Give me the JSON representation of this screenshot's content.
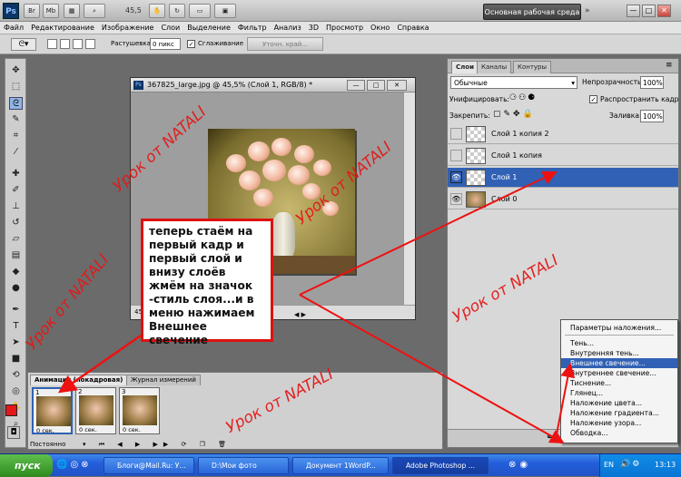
{
  "app": {
    "logo": "Ps",
    "buttons": {
      "br": "Br",
      "mb": "Mb"
    },
    "zoom": "45,5",
    "workspace": "Основная рабочая среда",
    "window_controls": [
      "—",
      "□",
      "✕"
    ]
  },
  "menu": [
    "Файл",
    "Редактирование",
    "Изображение",
    "Слои",
    "Выделение",
    "Фильтр",
    "Анализ",
    "3D",
    "Просмотр",
    "Окно",
    "Справка"
  ],
  "options": {
    "feather_label": "Растушевка:",
    "feather_value": "0 пикс",
    "antialias_label": "Сглаживание",
    "refine_edge": "Уточн. край..."
  },
  "document": {
    "title": "367825_large.jpg @ 45,5% (Слой 1, RGB/8) *",
    "zoom_status": "45,5%"
  },
  "callout": {
    "text": "теперь стаём на первый кадр и первый слой и внизу слоёв жмём на значок -стиль слоя...и в меню нажимаем Внешнее свечение"
  },
  "layers_panel": {
    "tabs": [
      "Слои",
      "Каналы",
      "Контуры"
    ],
    "blend_mode": "Обычные",
    "opacity_label": "Непрозрачность:",
    "opacity_value": "100%",
    "unify_label": "Унифицировать:",
    "propagate_label": "Распространить кадр 1",
    "lock_label": "Закрепить:",
    "fill_label": "Заливка:",
    "fill_value": "100%",
    "layers": [
      "Слой 1 копия 2",
      "Слой 1 копия",
      "Слой 1",
      "Слой 0"
    ]
  },
  "context_menu": {
    "items": [
      "Параметры наложения...",
      "Тень...",
      "Внутренняя тень...",
      "Внешнее свечение...",
      "Внутреннее свечение...",
      "Тиснение...",
      "Глянец...",
      "Наложение цвета...",
      "Наложение градиента...",
      "Наложение узора...",
      "Обводка..."
    ],
    "highlighted": "Внешнее свечение..."
  },
  "animation": {
    "tabs": [
      "Анимация (покадровая)",
      "Журнал измерений"
    ],
    "frames": [
      {
        "num": "1",
        "time": "0 сек."
      },
      {
        "num": "2",
        "time": "0 сек."
      },
      {
        "num": "3",
        "time": "0 сек."
      }
    ],
    "loop": "Постоянно"
  },
  "watermark": "Урок от  NATALI",
  "taskbar": {
    "start": "пуск",
    "tasks": [
      "Блоги@Mail.Ru: У...",
      "D:\\Мои фото",
      "Документ 1WordP...",
      "Adobe Photoshop ..."
    ],
    "lang": "EN",
    "clock": "13:13"
  },
  "colors": {
    "accent": "#3161b4",
    "watermark": "#e41818",
    "callout_border": "#dd1111"
  }
}
